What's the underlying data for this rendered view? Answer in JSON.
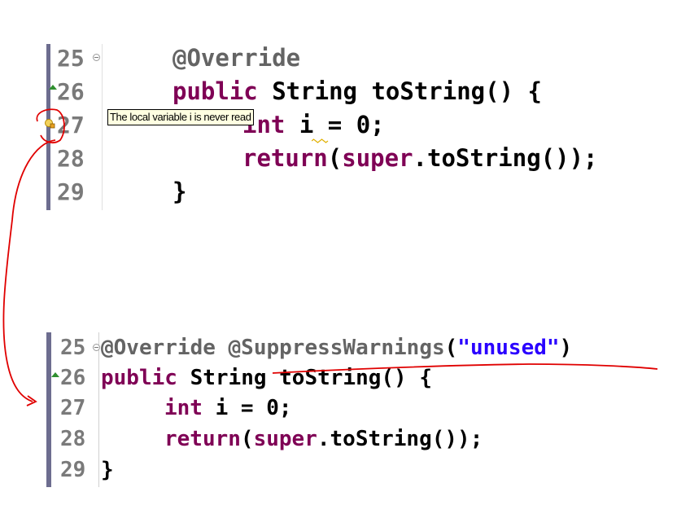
{
  "tooltip": "The local variable i is never read",
  "editor1": {
    "line_numbers": [
      "25",
      "26",
      "27",
      "28",
      "29"
    ],
    "lines": [
      {
        "tokens": [
          {
            "t": "@Override",
            "c": "ann"
          }
        ]
      },
      {
        "tokens": [
          {
            "t": "public",
            "c": "kw"
          },
          {
            "t": " String toString() {",
            "c": "plain"
          }
        ]
      },
      {
        "tokens": [
          {
            "t": "int",
            "c": "kw"
          },
          {
            "t": " i = 0;",
            "c": "plain"
          }
        ]
      },
      {
        "tokens": [
          {
            "t": "return",
            "c": "kw"
          },
          {
            "t": "(",
            "c": "plain"
          },
          {
            "t": "super",
            "c": "kw"
          },
          {
            "t": ".toString());",
            "c": "plain"
          }
        ]
      },
      {
        "tokens": [
          {
            "t": "}",
            "c": "plain"
          }
        ]
      }
    ]
  },
  "editor2": {
    "line_numbers": [
      "25",
      "26",
      "27",
      "28",
      "29"
    ],
    "lines": [
      {
        "tokens": [
          {
            "t": "@Override @SuppressWarnings",
            "c": "ann"
          },
          {
            "t": "(",
            "c": "plain"
          },
          {
            "t": "\"unused\"",
            "c": "str"
          },
          {
            "t": ")",
            "c": "plain"
          }
        ]
      },
      {
        "tokens": [
          {
            "t": "public",
            "c": "kw"
          },
          {
            "t": " String toString() {",
            "c": "plain"
          }
        ]
      },
      {
        "tokens": [
          {
            "t": "int",
            "c": "kw"
          },
          {
            "t": " i = 0;",
            "c": "plain"
          }
        ]
      },
      {
        "tokens": [
          {
            "t": "return",
            "c": "kw"
          },
          {
            "t": "(",
            "c": "plain"
          },
          {
            "t": "super",
            "c": "kw"
          },
          {
            "t": ".toString());",
            "c": "plain"
          }
        ]
      },
      {
        "tokens": [
          {
            "t": "}",
            "c": "plain"
          }
        ]
      }
    ]
  },
  "colors": {
    "keyword": "#7f0055",
    "annotation": "#646464",
    "string": "#2a00ff",
    "markup_pen": "#e00000",
    "gutter_bar": "#6d6d8f"
  },
  "icons": [
    "fold-collapse-icon",
    "override-marker-icon",
    "warning-quick-fix-icon"
  ]
}
